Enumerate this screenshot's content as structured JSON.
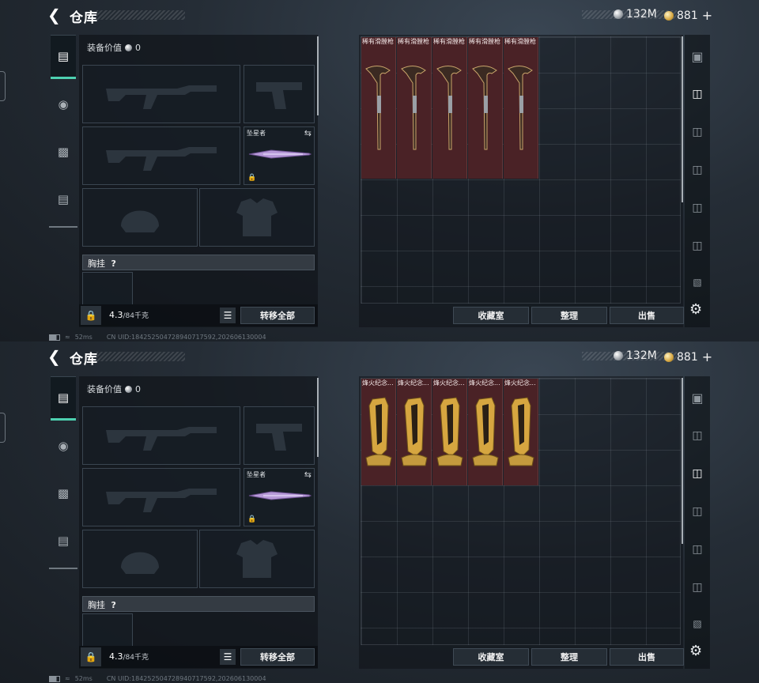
{
  "screens": [
    {
      "title": "仓库",
      "currency": {
        "silver": "132M",
        "gold": "881",
        "gold_plus": "+"
      },
      "equip_value_label": "装备价值",
      "equip_value": "0",
      "melee_slot_name": "坠星者",
      "chest_label": "胸挂",
      "chest_help": "?",
      "weight_value": "4.3",
      "weight_max": "/84千克",
      "transfer_all": "转移全部",
      "buttons": {
        "collection": "收藏室",
        "organize": "整理",
        "sell": "出售"
      },
      "stash_items": [
        "稀有滑膛枪",
        "稀有滑膛枪",
        "稀有滑膛枪",
        "稀有滑膛枪",
        "稀有滑膛枪"
      ],
      "stash_item_icon": "musket-icon",
      "active_right_tab": 1,
      "network": "52ms",
      "uid_text": "CN UID:18425250472894071759​2,202606130004"
    },
    {
      "title": "仓库",
      "currency": {
        "silver": "132M",
        "gold": "881",
        "gold_plus": "+"
      },
      "equip_value_label": "装备价值",
      "equip_value": "0",
      "melee_slot_name": "坠星者",
      "chest_label": "胸挂",
      "chest_help": "?",
      "weight_value": "4.3",
      "weight_max": "/84千克",
      "transfer_all": "转移全部",
      "buttons": {
        "collection": "收藏室",
        "organize": "整理",
        "sell": "出售"
      },
      "stash_items": [
        "烽火纪念...",
        "烽火纪念...",
        "烽火纪念...",
        "烽火纪念...",
        "烽火纪念..."
      ],
      "stash_item_icon": "trophy-icon",
      "active_right_tab": 2,
      "network": "52ms",
      "uid_text": "CN UID:18425250472894071759​2,202606130004"
    }
  ],
  "colors": {
    "accent": "#4dd0b0",
    "item_bg": "#4a2226",
    "gold": "#d6a640"
  }
}
